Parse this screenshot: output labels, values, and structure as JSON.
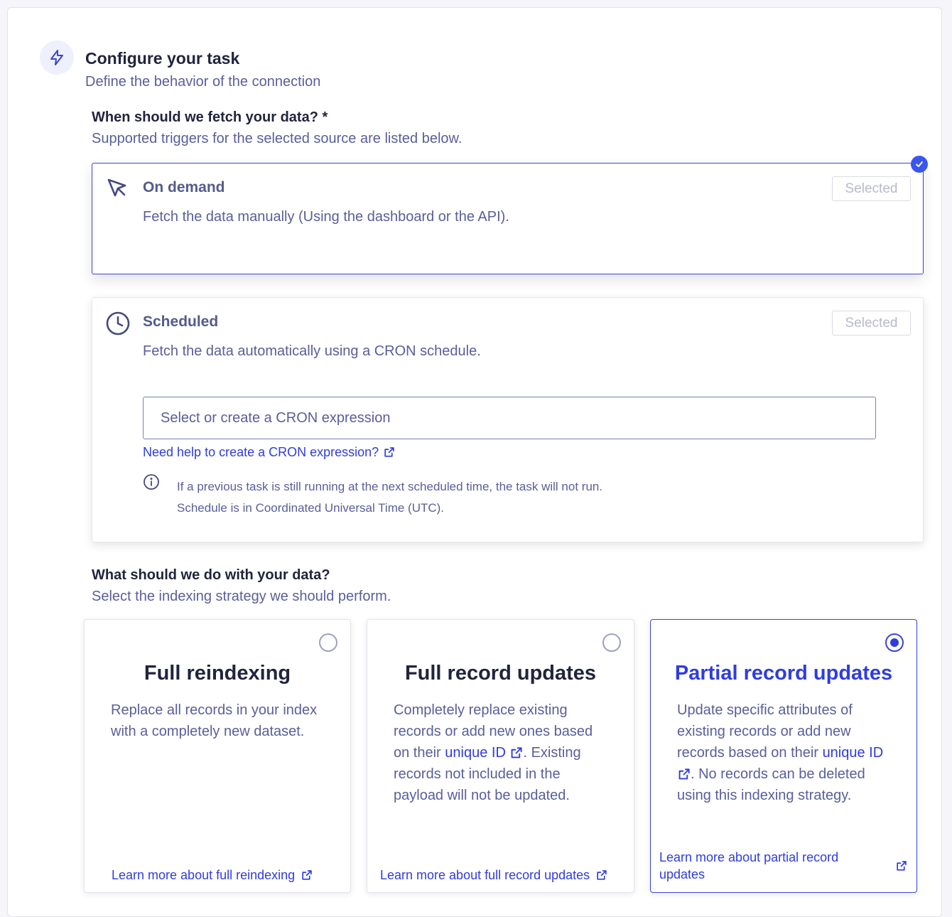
{
  "section": {
    "icon": "lightning-icon",
    "title": "Configure your task",
    "subtitle": "Define the behavior of the connection"
  },
  "fetch": {
    "question": "When should we fetch your data? *",
    "hint": "Supported triggers for the selected source are listed below.",
    "options": [
      {
        "icon": "cursor-arrow-icon",
        "title": "On demand",
        "description": "Fetch the data manually (Using the dashboard or the API).",
        "button": "Selected",
        "selected": true
      },
      {
        "icon": "clock-icon",
        "title": "Scheduled",
        "description": "Fetch the data automatically using a CRON schedule.",
        "button": "Selected",
        "selected": false,
        "cron_placeholder": "Select or create a CRON expression",
        "cron_help_link": "Need help to create a CRON expression?",
        "info_lines": [
          "If a previous task is still running at the next scheduled time, the task will not run.",
          "Schedule is in Coordinated Universal Time (UTC)."
        ]
      }
    ]
  },
  "strategy": {
    "question": "What should we do with your data?",
    "hint": "Select the indexing strategy we should perform.",
    "options": [
      {
        "title": "Full reindexing",
        "desc_before": "Replace all records in your index with a completely new dataset.",
        "link": "Learn more about full reindexing",
        "checked": false
      },
      {
        "title": "Full record updates",
        "desc_before": "Completely replace existing records or add new ones based on their ",
        "desc_link": "unique ID",
        "desc_after": ". Existing records not included in the payload will not be updated.",
        "link": "Learn more about full record updates",
        "checked": false
      },
      {
        "title": "Partial record updates",
        "desc_before": "Update specific attributes of existing records or add new records based on their ",
        "desc_link": "unique ID",
        "desc_after": ". No records can be deleted using this indexing strategy.",
        "link": "Learn more about partial record updates",
        "checked": true
      }
    ]
  },
  "colors": {
    "accent": "#2f3ce0",
    "text_muted": "#5a5e9a",
    "heading": "#21243d"
  }
}
